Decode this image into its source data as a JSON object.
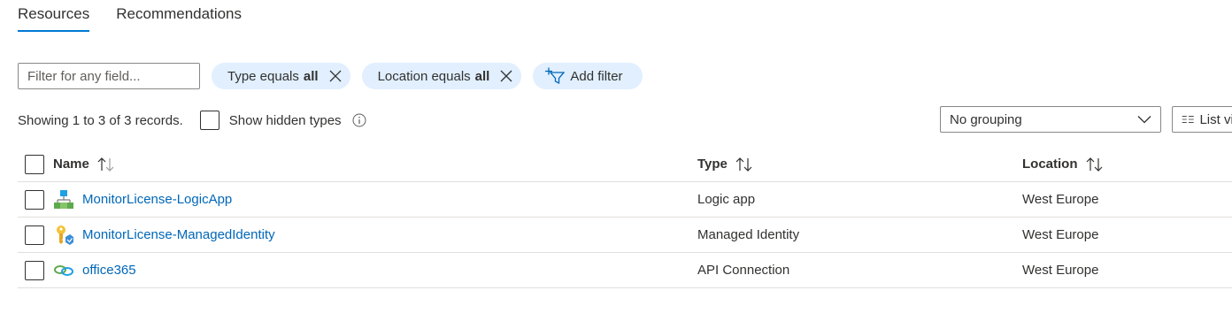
{
  "tabs": [
    {
      "label": "Resources",
      "active": true
    },
    {
      "label": "Recommendations",
      "active": false
    }
  ],
  "filter": {
    "placeholder": "Filter for any field...",
    "pills": [
      {
        "prefix": "Type equals",
        "value": "all"
      },
      {
        "prefix": "Location equals",
        "value": "all"
      }
    ],
    "add_label": "Add filter"
  },
  "info": {
    "records": "Showing 1 to 3 of 3 records.",
    "hidden_types_label": "Show hidden types"
  },
  "grouping": {
    "selected": "No grouping"
  },
  "view": {
    "label": "List view"
  },
  "table": {
    "headers": {
      "name": "Name",
      "type": "Type",
      "location": "Location"
    },
    "rows": [
      {
        "name": "MonitorLicense-LogicApp",
        "type": "Logic app",
        "location": "West Europe",
        "icon": "logic-app-icon"
      },
      {
        "name": "MonitorLicense-ManagedIdentity",
        "type": "Managed Identity",
        "location": "West Europe",
        "icon": "managed-identity-icon"
      },
      {
        "name": "office365",
        "type": "API Connection",
        "location": "West Europe",
        "icon": "api-connection-icon"
      }
    ]
  },
  "colors": {
    "accent": "#0078d4",
    "link": "#0067b8",
    "pill_bg": "#e1efff"
  }
}
